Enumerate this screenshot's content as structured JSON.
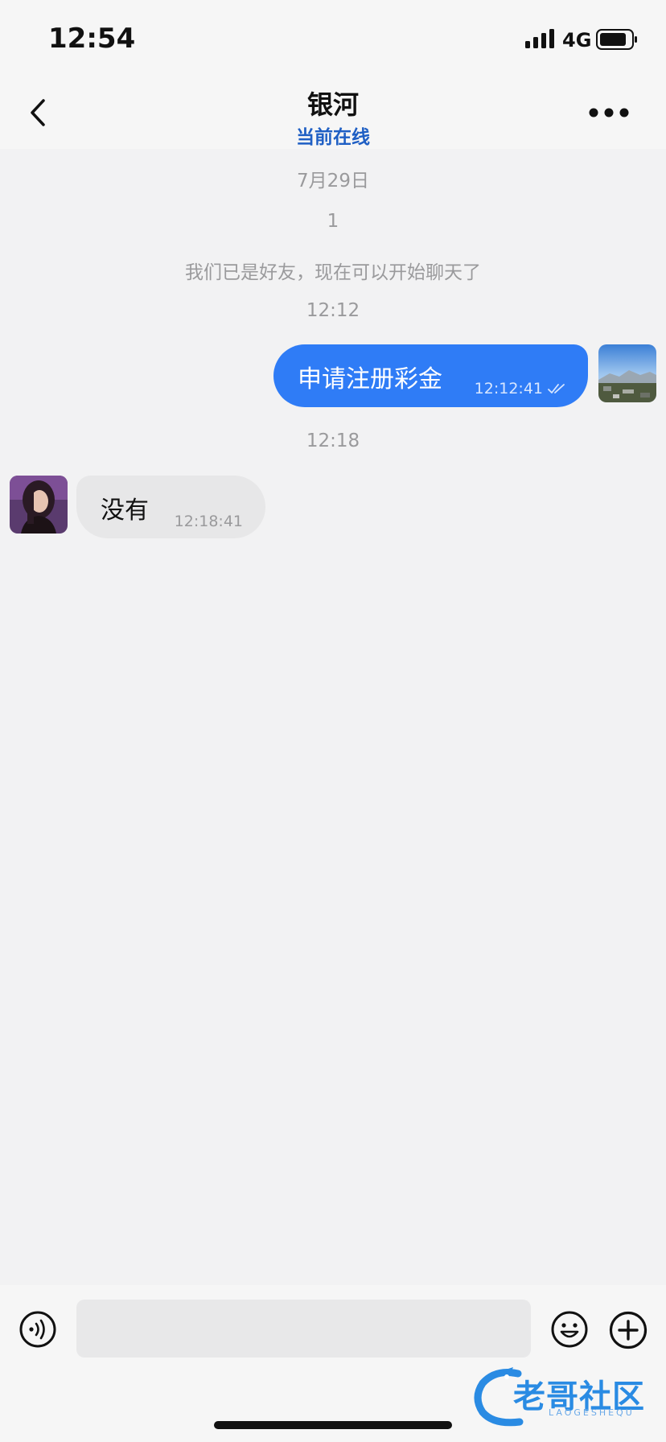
{
  "status_bar": {
    "time": "12:54",
    "network": "4G"
  },
  "header": {
    "title": "银河",
    "subtitle": "当前在线"
  },
  "chat": {
    "date_label": "7月29日",
    "system_number": "1",
    "system_notice": "我们已是好友，现在可以开始聊天了",
    "time_divider_1": "12:12",
    "outgoing_message": {
      "text": "申请注册彩金",
      "time": "12:12:41"
    },
    "time_divider_2": "12:18",
    "incoming_message": {
      "text": "没有",
      "time": "12:18:41"
    }
  },
  "composer": {
    "placeholder": ""
  },
  "watermark": {
    "text": "老哥社区",
    "subtext": "LAOGESHEQU"
  },
  "colors": {
    "outgoing_bubble": "#2f7cf6",
    "incoming_bubble": "#e7e7e8",
    "online_status": "#1f5fc4"
  },
  "icons": [
    "back-icon",
    "more-icon",
    "voice-icon",
    "emoji-icon",
    "plus-icon",
    "read-receipt-icon"
  ]
}
